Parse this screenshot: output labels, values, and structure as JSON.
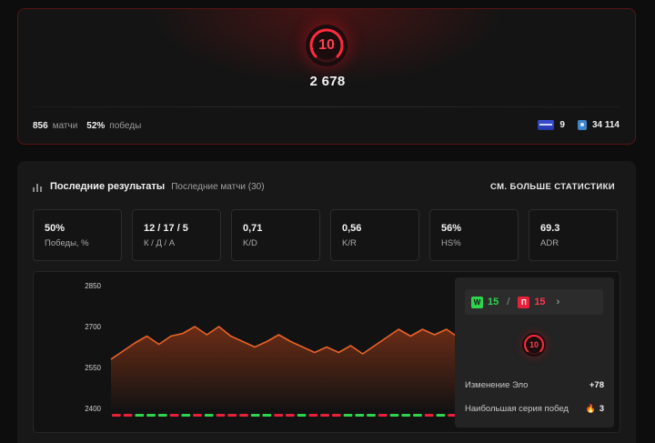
{
  "hero": {
    "level": "10",
    "elo": "2 678",
    "matches_value": "856",
    "matches_label": "матчи",
    "wins_value": "52%",
    "wins_label": "победы",
    "card_icon": "card-icon",
    "card_value": "9",
    "cup_icon": "cup-icon",
    "points_value": "34 114"
  },
  "recent": {
    "title": "Последние результаты",
    "subtitle": "Последние матчи (30)",
    "more_link": "СМ. БОЛЬШЕ СТАТИСТИКИ",
    "stats": [
      {
        "value": "50%",
        "label": "Победы, %"
      },
      {
        "value": "12 / 17 / 5",
        "label": "К / Д / А"
      },
      {
        "value": "0,71",
        "label": "K/D"
      },
      {
        "value": "0,56",
        "label": "K/R"
      },
      {
        "value": "56%",
        "label": "HS%"
      },
      {
        "value": "69.3",
        "label": "ADR"
      }
    ]
  },
  "side": {
    "wins_badge": "W",
    "wins": "15",
    "separator": "/",
    "losses_badge": "П",
    "losses": "15",
    "level": "10",
    "elo_change_label": "Изменение Эло",
    "elo_change_value": "+78",
    "streak_label": "Наибольшая серия побед",
    "streak_value": "3"
  },
  "colors": {
    "accent_red": "#e8203a",
    "win_green": "#2fd44d",
    "line_orange": "#e8632a"
  },
  "chart_data": {
    "type": "area",
    "yticks": [
      2850,
      2700,
      2550,
      2400
    ],
    "ylim": [
      2400,
      2850
    ],
    "x": [
      1,
      2,
      3,
      4,
      5,
      6,
      7,
      8,
      9,
      10,
      11,
      12,
      13,
      14,
      15,
      16,
      17,
      18,
      19,
      20,
      21,
      22,
      23,
      24,
      25,
      26,
      27,
      28,
      29,
      30
    ],
    "values": [
      2580,
      2610,
      2640,
      2665,
      2635,
      2665,
      2675,
      2700,
      2670,
      2700,
      2665,
      2645,
      2625,
      2645,
      2670,
      2645,
      2625,
      2605,
      2625,
      2605,
      2630,
      2600,
      2630,
      2660,
      2690,
      2665,
      2690,
      2670,
      2690,
      2660
    ],
    "results": [
      "L",
      "L",
      "W",
      "W",
      "W",
      "L",
      "W",
      "L",
      "W",
      "L",
      "L",
      "L",
      "W",
      "W",
      "L",
      "L",
      "W",
      "L",
      "L",
      "L",
      "W",
      "W",
      "W",
      "L",
      "W",
      "W",
      "W",
      "L",
      "W",
      "L"
    ]
  }
}
